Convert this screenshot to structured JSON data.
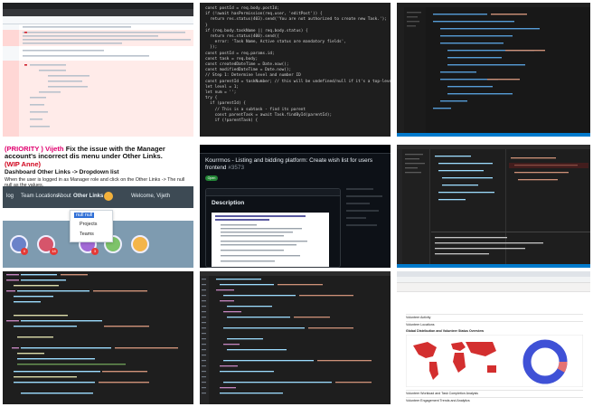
{
  "tiles": {
    "code_top_middle": {
      "lines": [
        "const postId = req.body.postId;",
        "if (!await hasPermission(req.user, 'editPost')) {",
        "  return res.status(403).send('You are not authorized to create new Task.');",
        "}",
        "",
        "if (req.body.taskName || req.body.status) {",
        "  return res.status(400).send({",
        "    error: 'Task Name, Active status are mandatory fields',",
        "  });",
        "",
        "const postId = req.params.id;",
        "const task = req.body;",
        "const createdDateTime = Date.now();",
        "const modifiedDateTime = Date.now();",
        "",
        "// Step 1: Determine level and number ID",
        "const parentId = taskNumber; // this will be undefined/null if it's a top-level task",
        "let level = 1;",
        "let num = '';",
        "",
        "try {",
        "  if (parentId) {",
        "    // This is a subtask - find its parent",
        "    const parentTask = await Task.findById(parentId);",
        "    if (!parentTask) {"
      ]
    },
    "issue": {
      "priority": "(PRIORITY )",
      "assignee": "Vijeth",
      "title": "Fix the issue with the Manager account's incorrect dis menu under Other Links.",
      "wip": "(WIP Anne)",
      "subtitle": "Dashboard Other Links -> Dropdown list",
      "body": "When the user is logged in as Manager role and click on the Other Links -> The null null as the values.",
      "nav_items": [
        "log",
        "Team Locations",
        "About",
        "Other Links"
      ],
      "welcome": "Welcome, Vijeth",
      "dropdown_selected": "null null",
      "dropdown_items": [
        "Projects",
        "Teams"
      ],
      "badges": [
        "0",
        "18",
        "3"
      ]
    },
    "github_pr": {
      "title": "Kourrmos - Listing and bidding platform: Create wish list for users frontend",
      "pr_number": "#3573",
      "status": "Open",
      "section_heading": "Description"
    },
    "analytics": {
      "section_titles": [
        "Volunteer Activity",
        "Volunteer Locations",
        "Global Distribution and Volunteer Status Overview",
        "Volunteer Workload and Task Completion Analysis",
        "Volunteer Engagement Trends and Analytics"
      ]
    }
  },
  "colors": {
    "dark_bg": "#1e1e1e",
    "github_dark": "#0d1117",
    "nav_bg": "#3d4a54",
    "priority": "#e0006e",
    "wip": "#d0021b",
    "map_red": "#d32f2f",
    "donut_blue": "#3f51d6"
  }
}
